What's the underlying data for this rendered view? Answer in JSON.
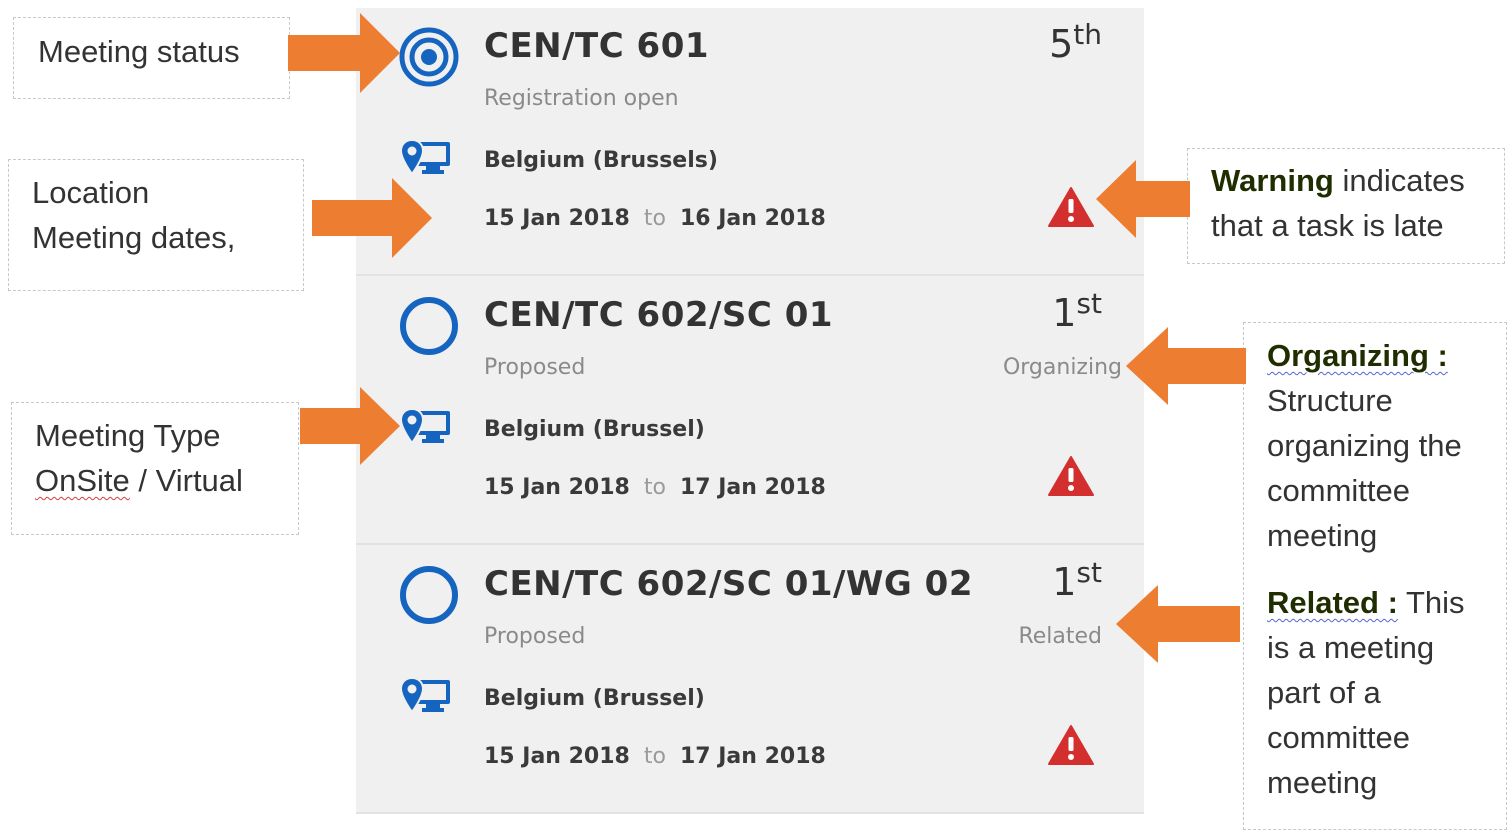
{
  "meetings": [
    {
      "code": "CEN/TC 601",
      "status": "Registration open",
      "status_icon": "target-icon",
      "session_number": "5",
      "session_suffix": "th",
      "role": "",
      "location": "Belgium (Brussels)",
      "date_from": "15 Jan 2018",
      "date_sep": "to",
      "date_to": "16 Jan 2018",
      "meeting_type_icon": "location-computer-icon",
      "warning_icon": "warning-triangle-icon"
    },
    {
      "code": "CEN/TC 602/SC 01",
      "status": "Proposed",
      "status_icon": "circle-outline-icon",
      "session_number": "1",
      "session_suffix": "st",
      "role": "Organizing",
      "location": "Belgium (Brussel)",
      "date_from": "15 Jan 2018",
      "date_sep": "to",
      "date_to": "17 Jan 2018",
      "meeting_type_icon": "location-computer-icon",
      "warning_icon": "warning-triangle-icon"
    },
    {
      "code": "CEN/TC 602/SC 01/WG 02",
      "status": "Proposed",
      "status_icon": "circle-outline-icon",
      "session_number": "1",
      "session_suffix": "st",
      "role": "Related",
      "location": "Belgium (Brussel)",
      "date_from": "15 Jan 2018",
      "date_sep": "to",
      "date_to": "17 Jan 2018",
      "meeting_type_icon": "location-computer-icon",
      "warning_icon": "warning-triangle-icon"
    }
  ],
  "annotations": {
    "meeting_status": "Meeting status",
    "location_line1": "Location",
    "location_line2": "Meeting dates,",
    "type_line1": "Meeting Type",
    "type_line2_a": "OnSite",
    "type_line2_b": " / Virtual",
    "warning_bold": "Warning",
    "warning_rest": " indicates",
    "warning_line2": "that a task is late",
    "organizing_bold": "Organizing :",
    "organizing_lines": [
      "Structure",
      "organizing the",
      "committee",
      "meeting"
    ],
    "related_bold": "Related :",
    "related_rest": " This",
    "related_lines": [
      "is a meeting",
      "part of a",
      "committee",
      "meeting"
    ]
  },
  "colors": {
    "accent_blue": "#1565c0",
    "warning_red": "#d32f2f",
    "arrow_orange": "#ed7d31",
    "card_bg": "#f0f0f0"
  }
}
